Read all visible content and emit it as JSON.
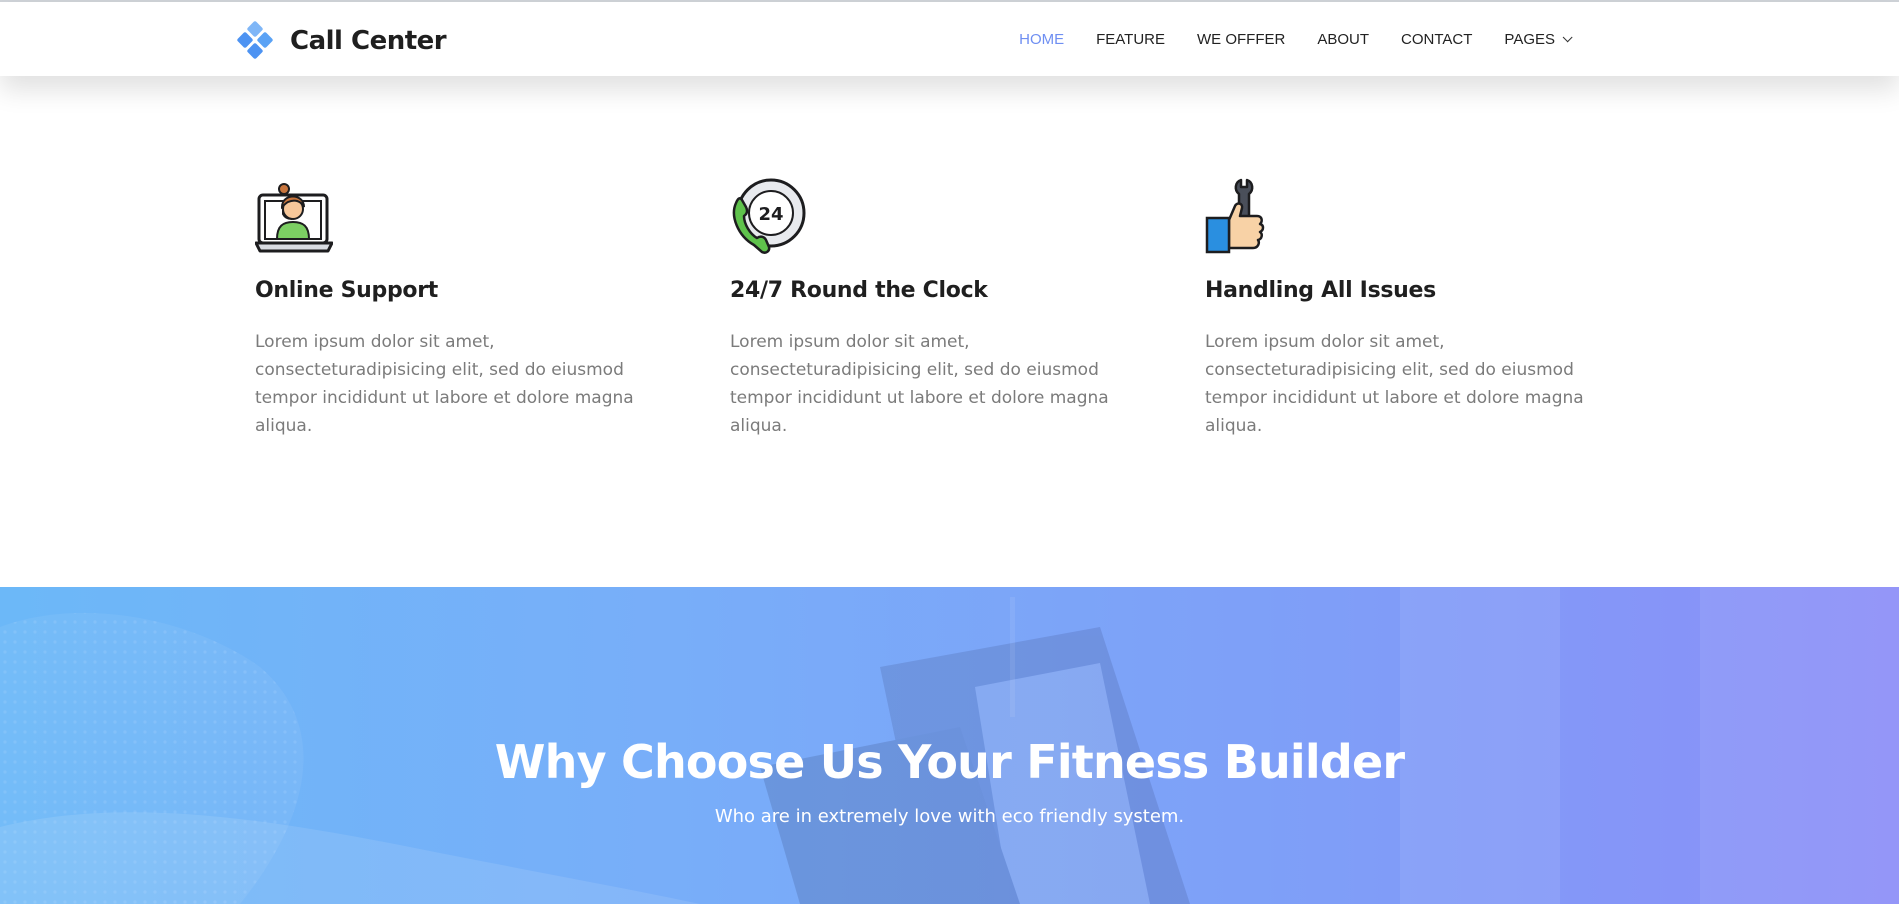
{
  "header": {
    "brand_name": "Call Center",
    "logo_icon": "diamond-cluster-icon",
    "nav": [
      {
        "label": "HOME",
        "active": true
      },
      {
        "label": "FEATURE",
        "active": false
      },
      {
        "label": "WE OFFFER",
        "active": false
      },
      {
        "label": "ABOUT",
        "active": false
      },
      {
        "label": "CONTACT",
        "active": false
      },
      {
        "label": "PAGES",
        "active": false,
        "has_dropdown": true
      }
    ]
  },
  "features": [
    {
      "icon": "online-support-agent-icon",
      "title": "Online Support",
      "text": "Lorem ipsum dolor sit amet, consecteturadipisicing elit, sed do eiusmod tempor incididunt ut labore et dolore magna aliqua."
    },
    {
      "icon": "phone-24-hours-icon",
      "title": "24/7 Round the Clock",
      "text": "Lorem ipsum dolor sit amet, consecteturadipisicing elit, sed do eiusmod tempor incididunt ut labore et dolore magna aliqua."
    },
    {
      "icon": "thumbs-up-wrench-icon",
      "title": "Handling All Issues",
      "text": "Lorem ipsum dolor sit amet, consecteturadipisicing elit, sed do eiusmod tempor incididunt ut labore et dolore magna aliqua."
    }
  ],
  "banner": {
    "title": "Why Choose Us Your Fitness Builder",
    "subtitle": "Who are in extremely love with eco friendly system."
  },
  "colors": {
    "accent": "#6f8ff2",
    "banner_start": "#6cb8f8",
    "banner_end": "#8b8ef8",
    "logo_blue": "#5aa2f5"
  }
}
